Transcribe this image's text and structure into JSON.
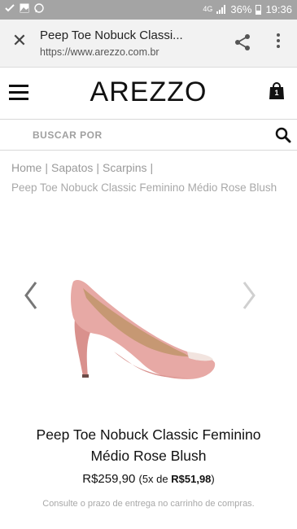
{
  "status_bar": {
    "network": "4G",
    "battery": "36%",
    "time": "19:36"
  },
  "browser": {
    "page_title": "Peep Toe Nobuck Classi...",
    "url": "https://www.arezzo.com.br"
  },
  "site": {
    "logo": "AREZZO",
    "cart_count": "1",
    "search_placeholder": "BUSCAR POR"
  },
  "breadcrumb": {
    "items": [
      "Home",
      "Sapatos",
      "Scarpins"
    ],
    "current": "Peep Toe Nobuck Classic Feminino Médio Rose Blush"
  },
  "product": {
    "name": "Peep Toe Nobuck Classic Feminino Médio Rose Blush",
    "price": "R$259,90",
    "installments_prefix": "(5x de",
    "installments_value": "R$51,98",
    "installments_suffix": ")",
    "shipping_note": "Consulte o prazo de entrega no carrinho de compras.",
    "color": "#e8a7a3"
  }
}
